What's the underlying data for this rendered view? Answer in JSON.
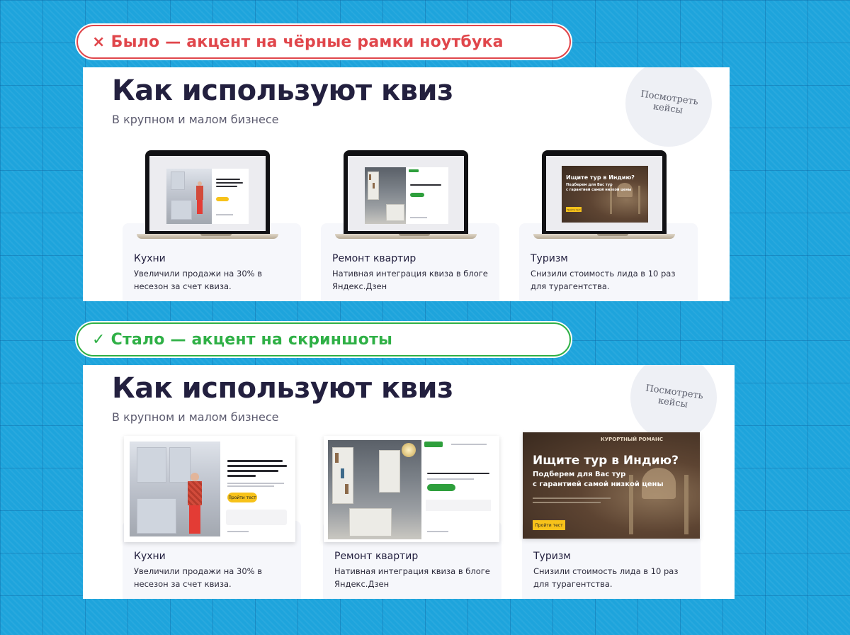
{
  "labels": {
    "before": {
      "mark": "×",
      "text": "Было — акцент на чёрные рамки ноутбука"
    },
    "after": {
      "mark": "✓",
      "text": "Стало — акцент на скриншоты"
    }
  },
  "section": {
    "title": "Как используют квиз",
    "subtitle": "В крупном и малом бизнесе",
    "cases_button": "Посмотреть кейсы",
    "cards": [
      {
        "title": "Кухни",
        "text": "Увеличили продажи на 30% в несезон за счет квиза."
      },
      {
        "title": "Ремонт квартир",
        "text": "Нативная интеграция квиза в блоге Яндекс.Дзен"
      },
      {
        "title": "Туризм",
        "text": "Снизили стоимость лида в 10 раз для турагентства."
      }
    ],
    "tourism_shot": {
      "brand": "КУРОРТНЫЙ РОМАНС",
      "headline": "Ищите тур в Индию?",
      "sub1": "Подберем для Вас тур",
      "sub2": "с гарантией самой низкой цены",
      "button": "Пройти тест"
    },
    "kitchen_shot": {
      "button": "Пройти тест"
    }
  },
  "colors": {
    "background": "#1ea4dc",
    "before_accent": "#e0464b",
    "after_accent": "#2fb046",
    "heading": "#23203f",
    "card_bg": "#f6f7fb"
  },
  "icons": {
    "before_mark": "cross-icon",
    "after_mark": "check-icon"
  }
}
